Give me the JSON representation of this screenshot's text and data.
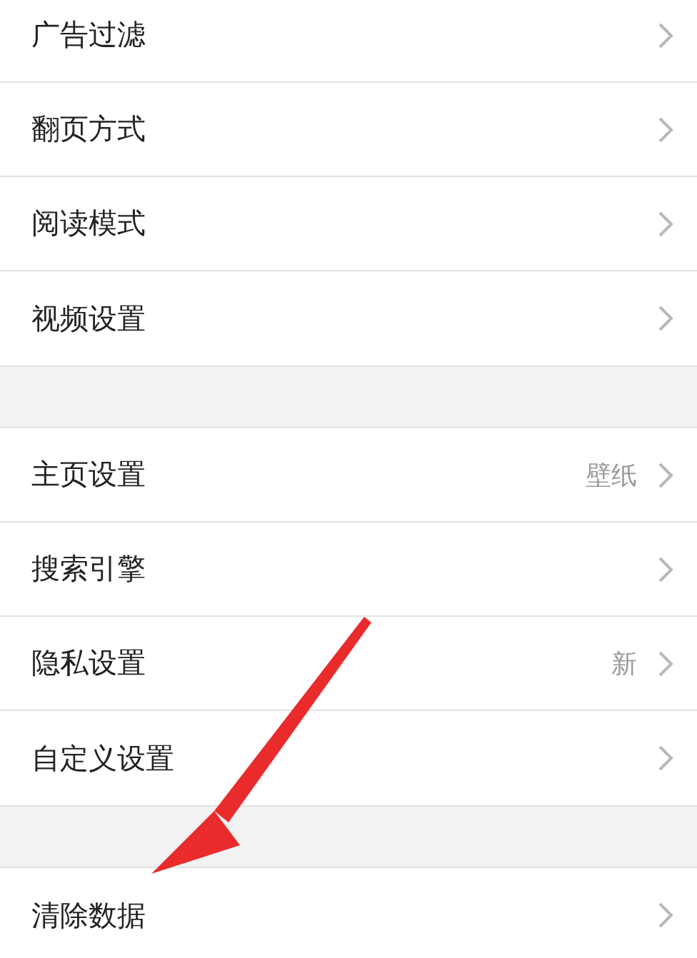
{
  "sections": [
    {
      "items": [
        {
          "label": "广告过滤"
        },
        {
          "label": "翻页方式"
        },
        {
          "label": "阅读模式"
        },
        {
          "label": "视频设置"
        }
      ]
    },
    {
      "items": [
        {
          "label": "主页设置",
          "value": "壁纸"
        },
        {
          "label": "搜索引擎"
        },
        {
          "label": "隐私设置",
          "value": "新"
        },
        {
          "label": "自定义设置"
        }
      ]
    },
    {
      "items": [
        {
          "label": "清除数据"
        }
      ]
    }
  ]
}
